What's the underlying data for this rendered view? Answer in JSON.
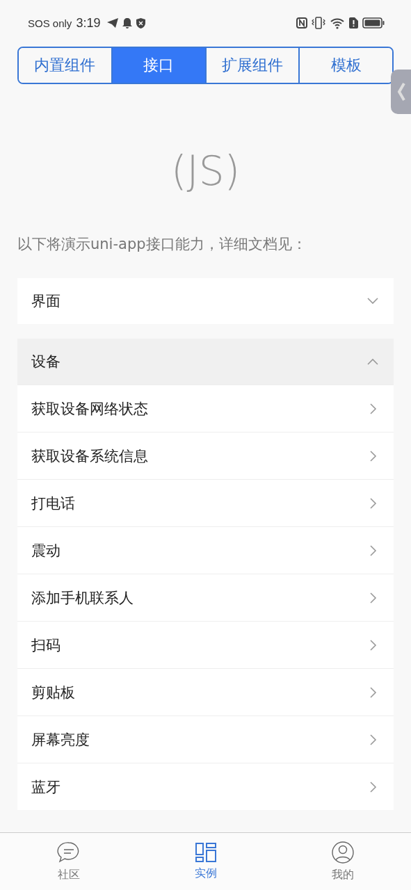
{
  "status_bar": {
    "carrier": "SOS only",
    "time": "3:19"
  },
  "tabs": [
    {
      "label": "内置组件",
      "selected": false
    },
    {
      "label": "接口",
      "selected": true
    },
    {
      "label": "扩展组件",
      "selected": false
    },
    {
      "label": "模板",
      "selected": false
    }
  ],
  "title": "(JS)",
  "intro": "以下将演示uni-app接口能力，详细文档见：",
  "sections": [
    {
      "label": "界面",
      "expanded": false
    },
    {
      "label": "设备",
      "expanded": true,
      "items": [
        "获取设备网络状态",
        "获取设备系统信息",
        "打电话",
        "震动",
        "添加手机联系人",
        "扫码",
        "剪贴板",
        "屏幕亮度",
        "蓝牙"
      ]
    }
  ],
  "tab_bar": [
    {
      "label": "社区",
      "kind": "chat",
      "selected": false
    },
    {
      "label": "实例",
      "kind": "grid",
      "selected": true
    },
    {
      "label": "我的",
      "kind": "user",
      "selected": false
    }
  ]
}
